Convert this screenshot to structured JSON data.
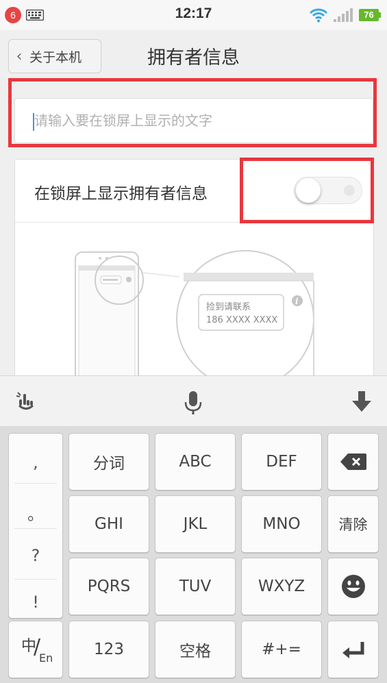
{
  "status_bar": {
    "notification_count": "6",
    "time": "12:17",
    "battery": "76",
    "icons": [
      "keyboard-icon",
      "wifi-icon",
      "signal-icon",
      "battery-icon"
    ]
  },
  "header": {
    "back_label": "关于本机",
    "title": "拥有者信息"
  },
  "owner_input": {
    "placeholder": "请输入要在锁屏上显示的文字",
    "value": ""
  },
  "lockscreen_setting": {
    "label": "在锁屏上显示拥有者信息",
    "toggle_on": false
  },
  "illustration": {
    "bubble_line1": "捡到请联系",
    "bubble_line2": "186 XXXX XXXX"
  },
  "keyboard": {
    "punctuation": [
      ",",
      "。",
      "?",
      "!"
    ],
    "row1": [
      "分词",
      "ABC",
      "DEF"
    ],
    "row2": [
      "GHI",
      "JKL",
      "MNO",
      "清除"
    ],
    "row3": [
      "PQRS",
      "TUV",
      "WXYZ"
    ],
    "lang_main": "中",
    "lang_sub": "En",
    "num_key": "123",
    "space_key": "空格",
    "symbol_key": "#+="
  },
  "colors": {
    "highlight": "#e8373e",
    "battery": "#66b82c",
    "wifi": "#3aa8e0",
    "cursor": "#4a90d9"
  }
}
